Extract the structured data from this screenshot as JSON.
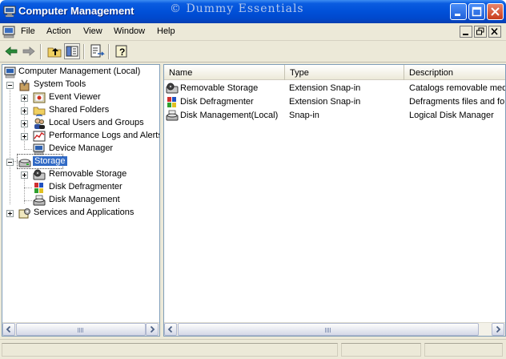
{
  "window": {
    "title": "Computer Management",
    "watermark": "© Dummy Essentials"
  },
  "menu": {
    "file": "File",
    "action": "Action",
    "view": "View",
    "window": "Window",
    "help": "Help"
  },
  "tree": {
    "root": "Computer Management (Local)",
    "system_tools": "System Tools",
    "event_viewer": "Event Viewer",
    "shared_folders": "Shared Folders",
    "local_users": "Local Users and Groups",
    "perf_logs": "Performance Logs and Alerts",
    "device_manager": "Device Manager",
    "storage": "Storage",
    "removable_storage": "Removable Storage",
    "disk_defragmenter": "Disk Defragmenter",
    "disk_management": "Disk Management",
    "services": "Services and Applications"
  },
  "list": {
    "headers": {
      "name": "Name",
      "type": "Type",
      "description": "Description"
    },
    "rows": [
      {
        "name": "Removable Storage",
        "type": "Extension Snap-in",
        "description": "Catalogs removable med"
      },
      {
        "name": "Disk Defragmenter",
        "type": "Extension Snap-in",
        "description": "Defragments files and fo"
      },
      {
        "name": "Disk Management(Local)",
        "type": "Snap-in",
        "description": "Logical Disk Manager"
      }
    ]
  },
  "colors": {
    "titlebar": "#0050d8",
    "selection": "#316ac5",
    "chrome": "#ece9d8"
  }
}
